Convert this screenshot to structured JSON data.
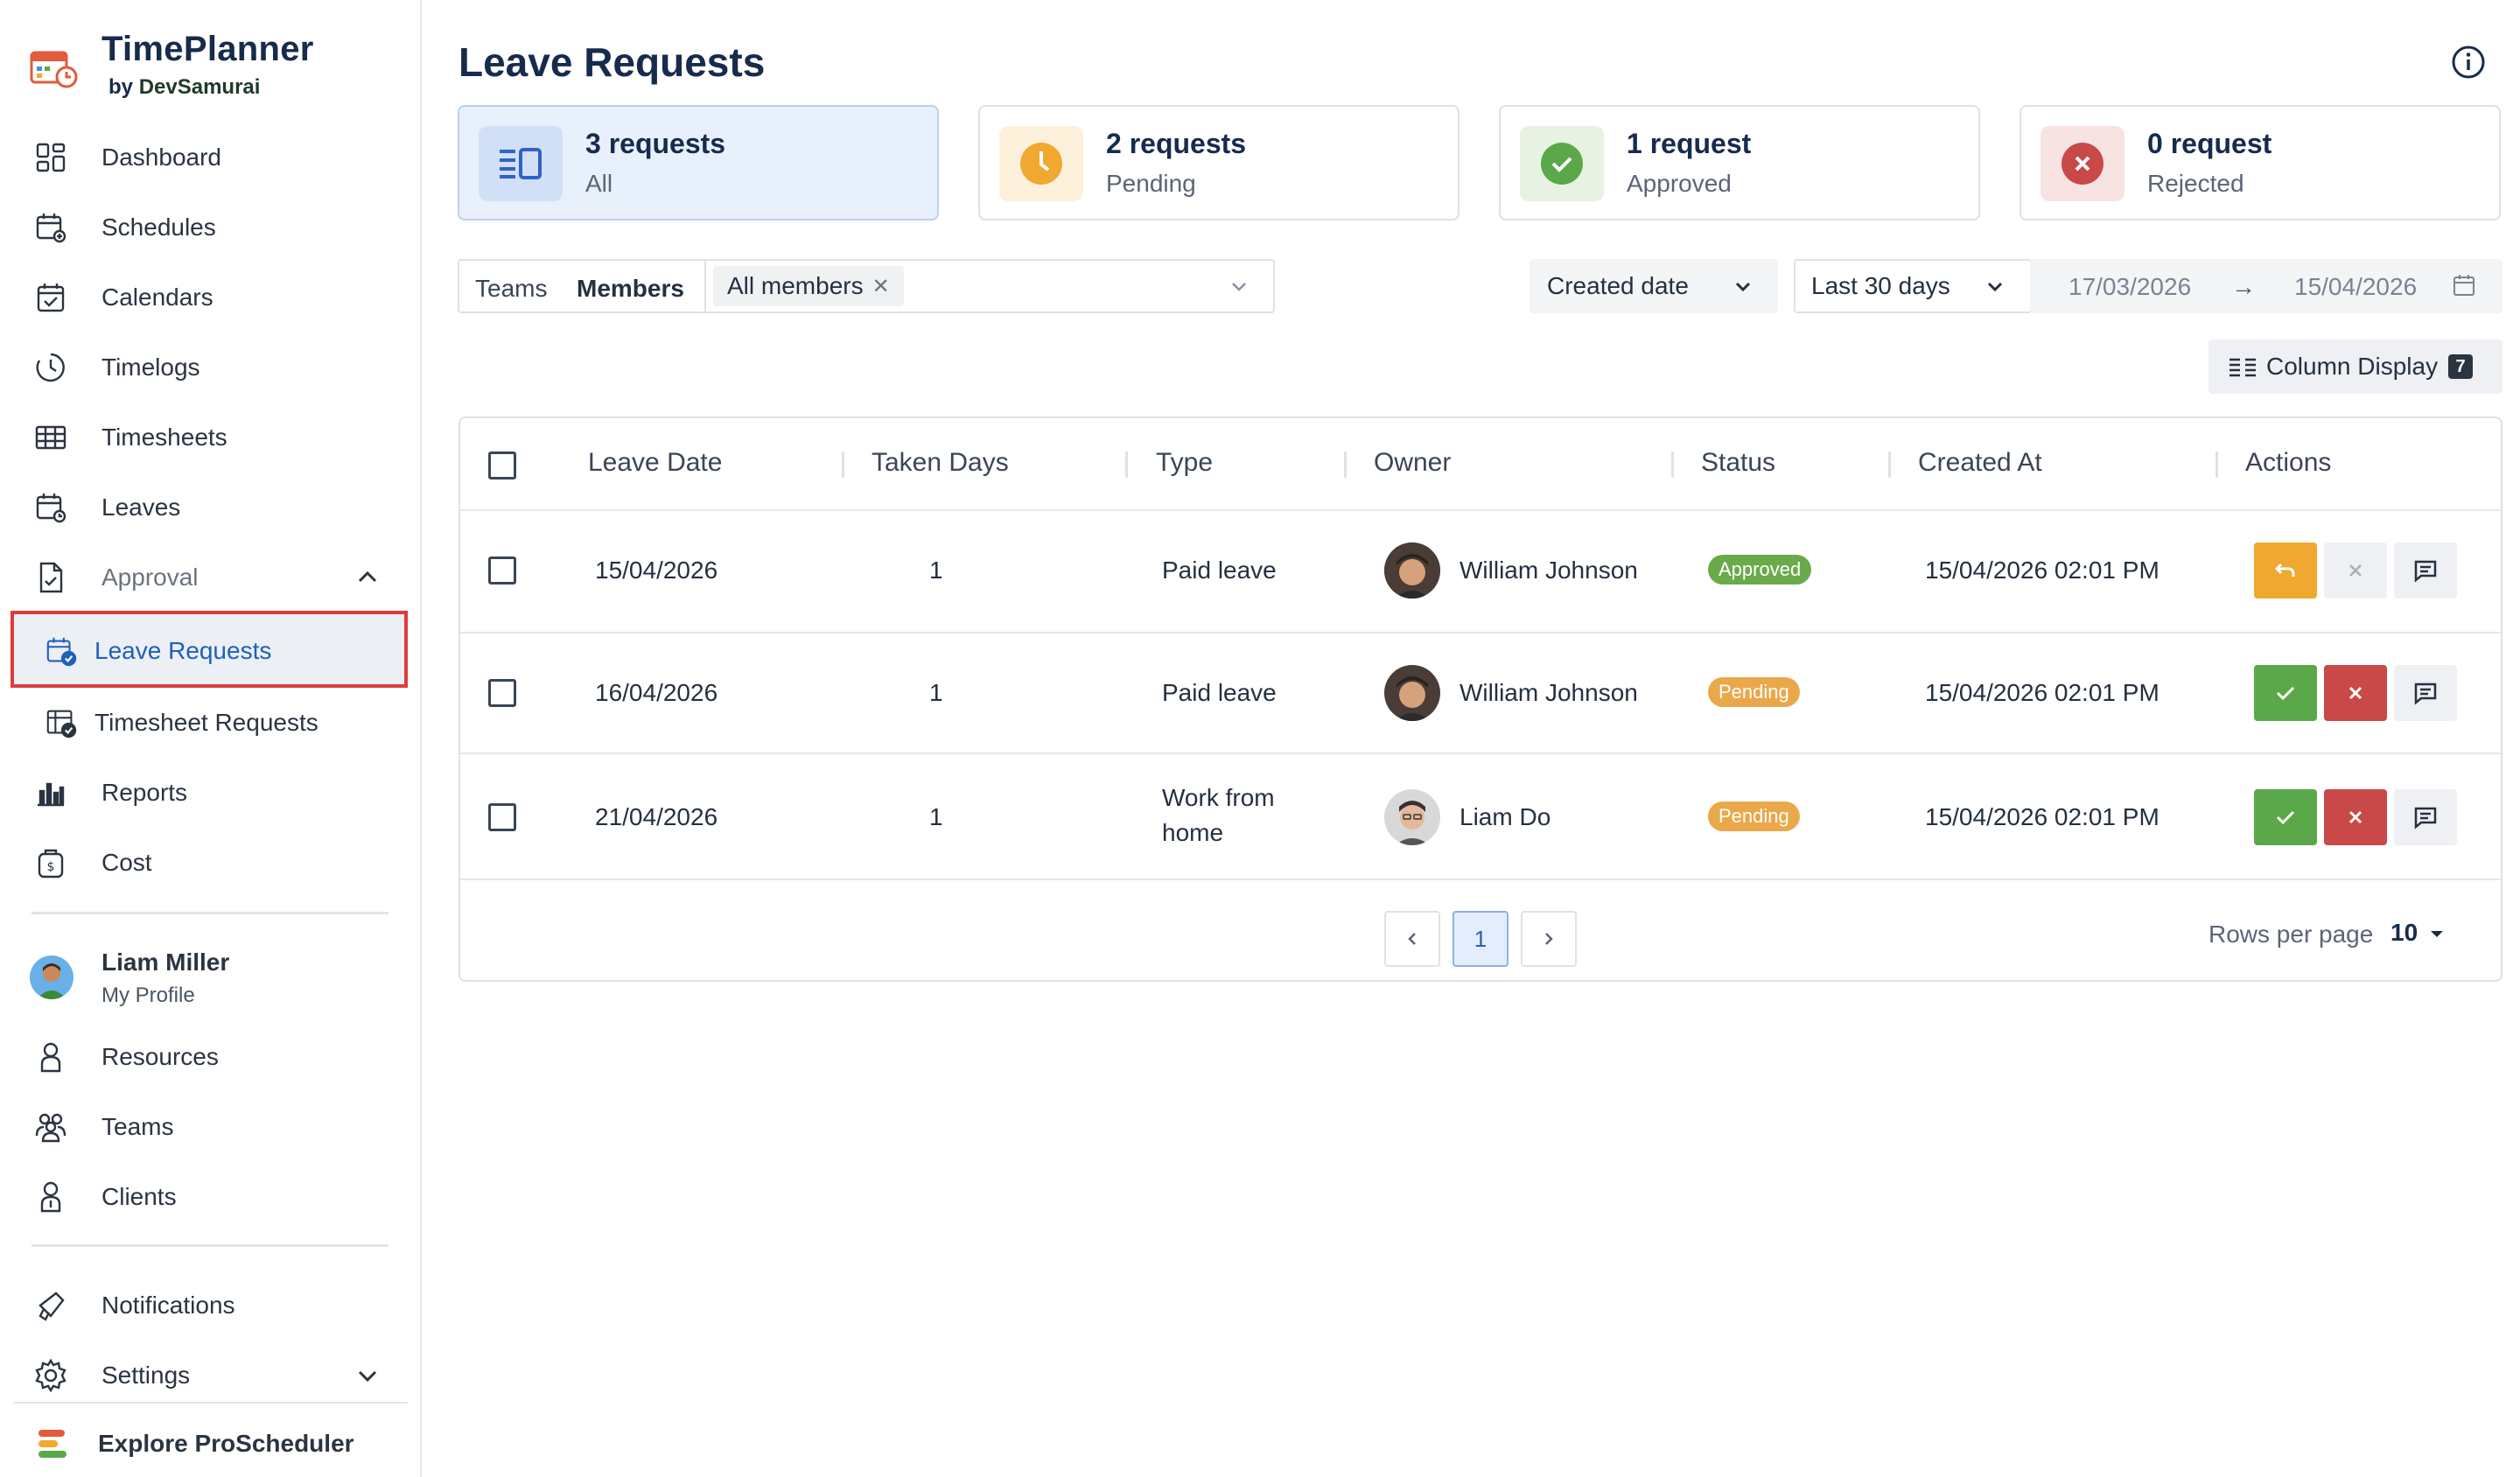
{
  "app": {
    "name": "TimePlanner",
    "by_prefix": "by",
    "by_brand": "DevSamurai"
  },
  "sidebar": {
    "items": [
      {
        "label": "Dashboard",
        "icon": "dashboard-icon"
      },
      {
        "label": "Schedules",
        "icon": "schedules-icon"
      },
      {
        "label": "Calendars",
        "icon": "calendar-check-icon"
      },
      {
        "label": "Timelogs",
        "icon": "clock-icon"
      },
      {
        "label": "Timesheets",
        "icon": "grid-table-icon"
      },
      {
        "label": "Leaves",
        "icon": "calendar-clock-icon"
      },
      {
        "label": "Approval",
        "icon": "document-check-icon"
      }
    ],
    "approval_children": [
      {
        "label": "Leave Requests",
        "icon": "calendar-check-badge-icon",
        "active": true
      },
      {
        "label": "Timesheet Requests",
        "icon": "table-check-icon"
      }
    ],
    "items_after": [
      {
        "label": "Reports",
        "icon": "bar-chart-icon"
      },
      {
        "label": "Cost",
        "icon": "money-bag-icon"
      }
    ],
    "profile": {
      "name": "Liam Miller",
      "sub": "My Profile"
    },
    "items_people": [
      {
        "label": "Resources",
        "icon": "person-icon"
      },
      {
        "label": "Teams",
        "icon": "group-icon"
      },
      {
        "label": "Clients",
        "icon": "client-icon"
      }
    ],
    "items_bottom": [
      {
        "label": "Notifications",
        "icon": "megaphone-icon"
      },
      {
        "label": "Settings",
        "icon": "gear-icon"
      }
    ],
    "explore": "Explore ProScheduler"
  },
  "main": {
    "title": "Leave Requests",
    "stats": [
      {
        "count": "3 requests",
        "label": "All",
        "color": "#3b6fd4"
      },
      {
        "count": "2 requests",
        "label": "Pending",
        "color": "#f0a830"
      },
      {
        "count": "1 request",
        "label": "Approved",
        "color": "#5aa84a"
      },
      {
        "count": "0 request",
        "label": "Rejected",
        "color": "#c94848"
      }
    ],
    "filters": {
      "tab_teams": "Teams",
      "tab_members": "Members",
      "member_chip": "All members",
      "date_type": "Created date",
      "range": "Last 30 days",
      "date_from": "17/03/2026",
      "date_arrow": "→",
      "date_to": "15/04/2026",
      "column_display": "Column Display",
      "column_count": "7"
    },
    "table": {
      "headers": [
        "Leave Date",
        "Taken Days",
        "Type",
        "Owner",
        "Status",
        "Created At",
        "Actions"
      ],
      "rows": [
        {
          "leave_date": "15/04/2026",
          "days": "1",
          "type": "Paid leave",
          "owner": "William Johnson",
          "status": "Approved",
          "created": "15/04/2026 02:01 PM"
        },
        {
          "leave_date": "16/04/2026",
          "days": "1",
          "type": "Paid leave",
          "owner": "William Johnson",
          "status": "Pending",
          "created": "15/04/2026 02:01 PM"
        },
        {
          "leave_date": "21/04/2026",
          "days": "1",
          "type_line1": "Work from",
          "type_line2": "home",
          "owner": "Liam Do",
          "status": "Pending",
          "created": "15/04/2026 02:01 PM"
        }
      ],
      "status_colors": {
        "Approved": "#6aaa4a",
        "Pending": "#eaa84a"
      }
    },
    "pagination": {
      "current": "1",
      "rows_label": "Rows per page",
      "rows_value": "10"
    }
  }
}
